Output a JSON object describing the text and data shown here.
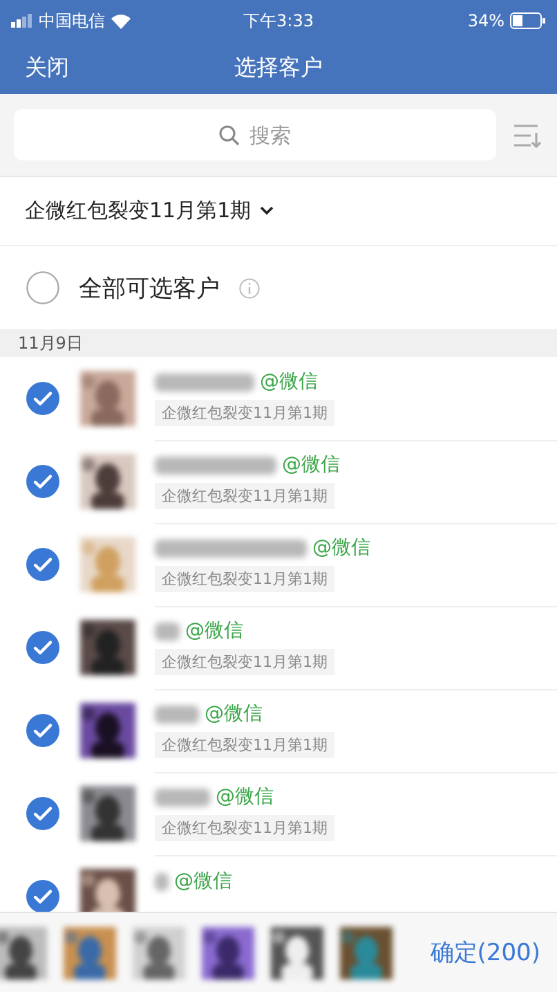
{
  "status_bar": {
    "carrier": "中国电信",
    "time": "下午3:33",
    "battery": "34%"
  },
  "nav": {
    "close": "关闭",
    "title": "选择客户"
  },
  "search": {
    "placeholder": "搜索"
  },
  "filter": {
    "label": "企微红包裂变11月第1期"
  },
  "select_all": {
    "label": "全部可选客户",
    "checked": false
  },
  "date_header": "11月9日",
  "customers": [
    {
      "source": "@微信",
      "tag": "企微红包裂变11月第1期",
      "checked": true
    },
    {
      "source": "@微信",
      "tag": "企微红包裂变11月第1期",
      "checked": true
    },
    {
      "source": "@微信",
      "tag": "企微红包裂变11月第1期",
      "checked": true
    },
    {
      "source": "@微信",
      "tag": "企微红包裂变11月第1期",
      "checked": true
    },
    {
      "source": "@微信",
      "tag": "企微红包裂变11月第1期",
      "checked": true
    },
    {
      "source": "@微信",
      "tag": "企微红包裂变11月第1期",
      "checked": true
    },
    {
      "source": "@微信",
      "checked": true
    }
  ],
  "bottom_bar": {
    "confirm": "确定(200)"
  }
}
